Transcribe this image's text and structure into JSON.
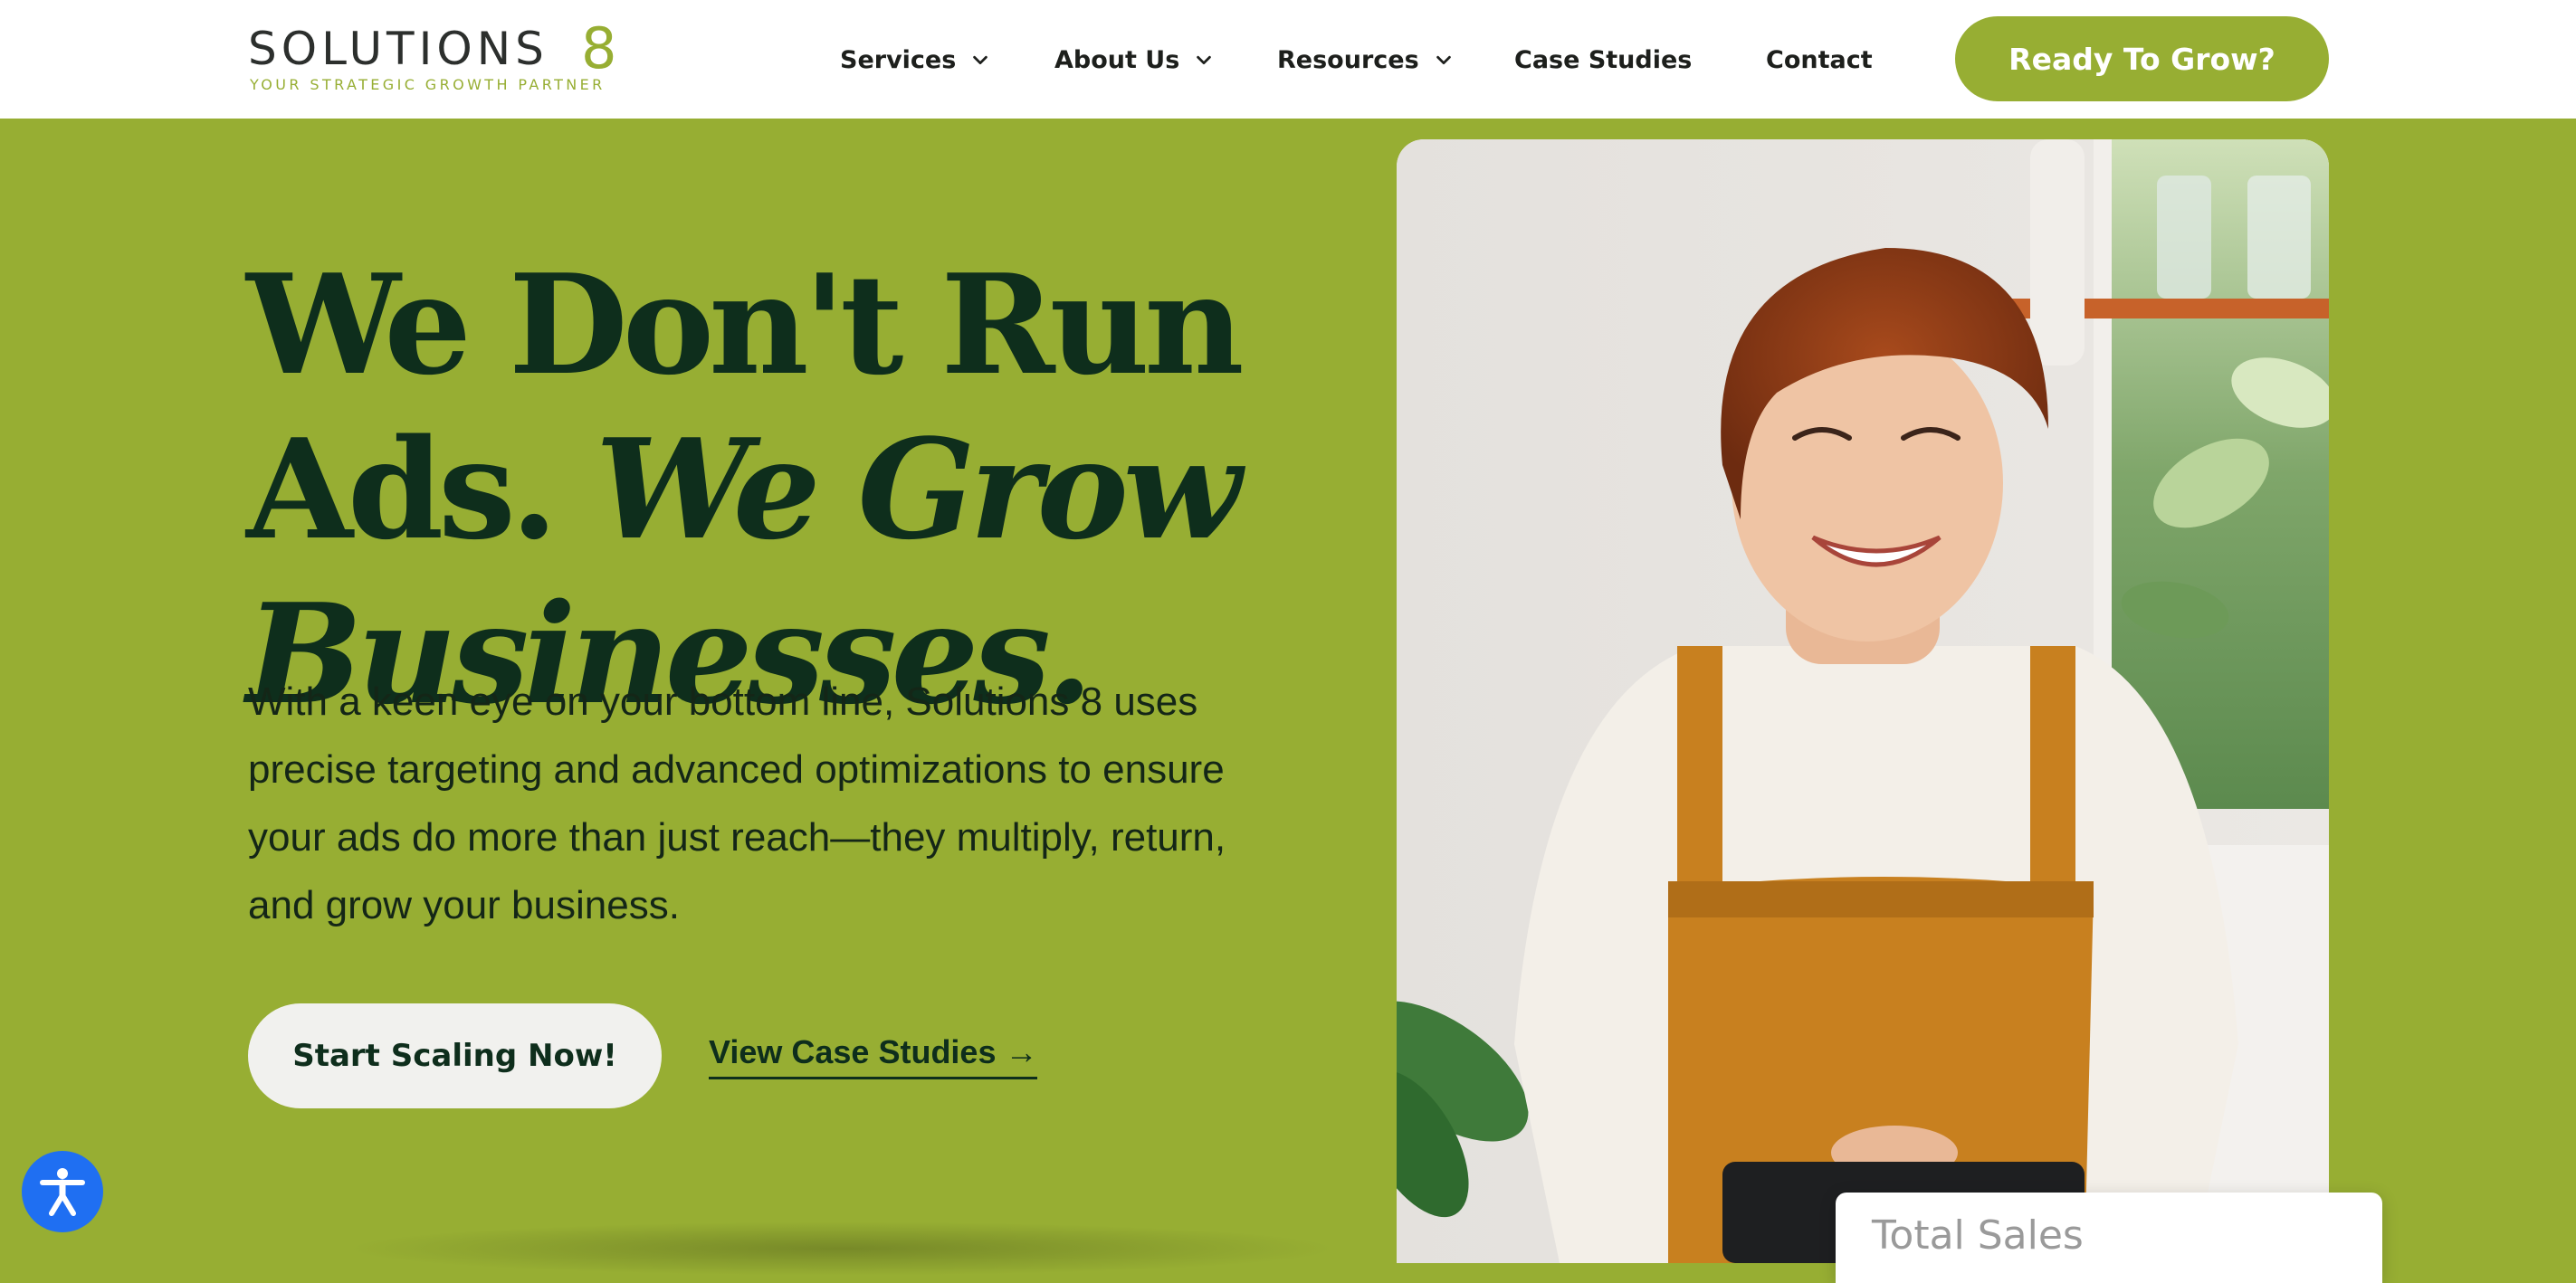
{
  "brand": {
    "name": "SOLUTIONS",
    "number": "8",
    "tagline": "YOUR STRATEGIC GROWTH PARTNER"
  },
  "nav": {
    "items": [
      {
        "label": "Services",
        "has_dropdown": true
      },
      {
        "label": "About Us",
        "has_dropdown": true
      },
      {
        "label": "Resources",
        "has_dropdown": true
      },
      {
        "label": "Case Studies",
        "has_dropdown": false
      },
      {
        "label": "Contact",
        "has_dropdown": false
      }
    ],
    "cta_label": "Ready To Grow?"
  },
  "hero": {
    "headline_line1": "We Don't Run",
    "headline_line2_plain": "Ads.",
    "headline_line2_italic": "We Grow",
    "headline_line3_italic": "Businesses.",
    "body": "With a keen eye on your bottom line, Solutions 8 uses precise targeting and advanced optimizations to ensure your ads do more than just reach—they multiply, return, and grow your business.",
    "primary_button": "Start Scaling Now!",
    "secondary_link": "View Case Studies →"
  },
  "sales_card": {
    "title": "Total Sales"
  },
  "icons": {
    "chevron": "chevron-down-icon",
    "accessibility": "accessibility-icon"
  },
  "colors": {
    "brand_green": "#97ae33",
    "dark_green": "#0e2e1c",
    "button_light": "#f1f1ee",
    "accessibility_blue": "#1f6ff2"
  }
}
